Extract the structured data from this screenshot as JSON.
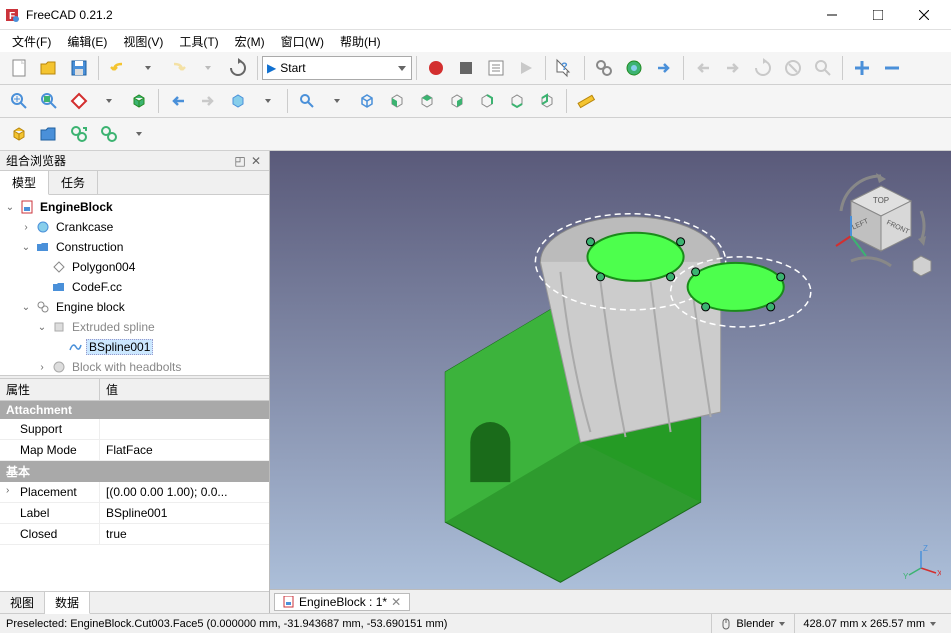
{
  "title": "FreeCAD 0.21.2",
  "menu": [
    "文件(F)",
    "编辑(E)",
    "视图(V)",
    "工具(T)",
    "宏(M)",
    "窗口(W)",
    "帮助(H)"
  ],
  "workbench": "Start",
  "panel_title": "组合浏览器",
  "tree_tabs": {
    "model": "模型",
    "tasks": "任务"
  },
  "tree": {
    "root": "EngineBlock",
    "n1": "Crankcase",
    "n2": "Construction",
    "n2a": "Polygon004",
    "n2b": "CodeF.cc",
    "n3": "Engine block",
    "n3a": "Extruded spline",
    "n3a1": "BSpline001",
    "n3b": "Block with headbolts"
  },
  "prop_headers": {
    "c1": "属性",
    "c2": "值"
  },
  "prop_groups": {
    "attachment": "Attachment",
    "base": "基本"
  },
  "props": {
    "support_k": "Support",
    "support_v": "",
    "mapmode_k": "Map Mode",
    "mapmode_v": "FlatFace",
    "placement_k": "Placement",
    "placement_v": "[(0.00 0.00 1.00); 0.0...",
    "label_k": "Label",
    "label_v": "BSpline001",
    "closed_k": "Closed",
    "closed_v": "true"
  },
  "bottom_tabs": {
    "view": "视图",
    "data": "数据"
  },
  "doc_tab": "EngineBlock : 1*",
  "status_left": "Preselected: EngineBlock.Cut003.Face5 (0.000000 mm, -31.943687 mm, -53.690151 mm)",
  "status_nav": "Blender",
  "status_dim": "428.07 mm x 265.57 mm",
  "navcube": {
    "top": "TOP",
    "front": "FRONT",
    "left": "LEFT"
  }
}
